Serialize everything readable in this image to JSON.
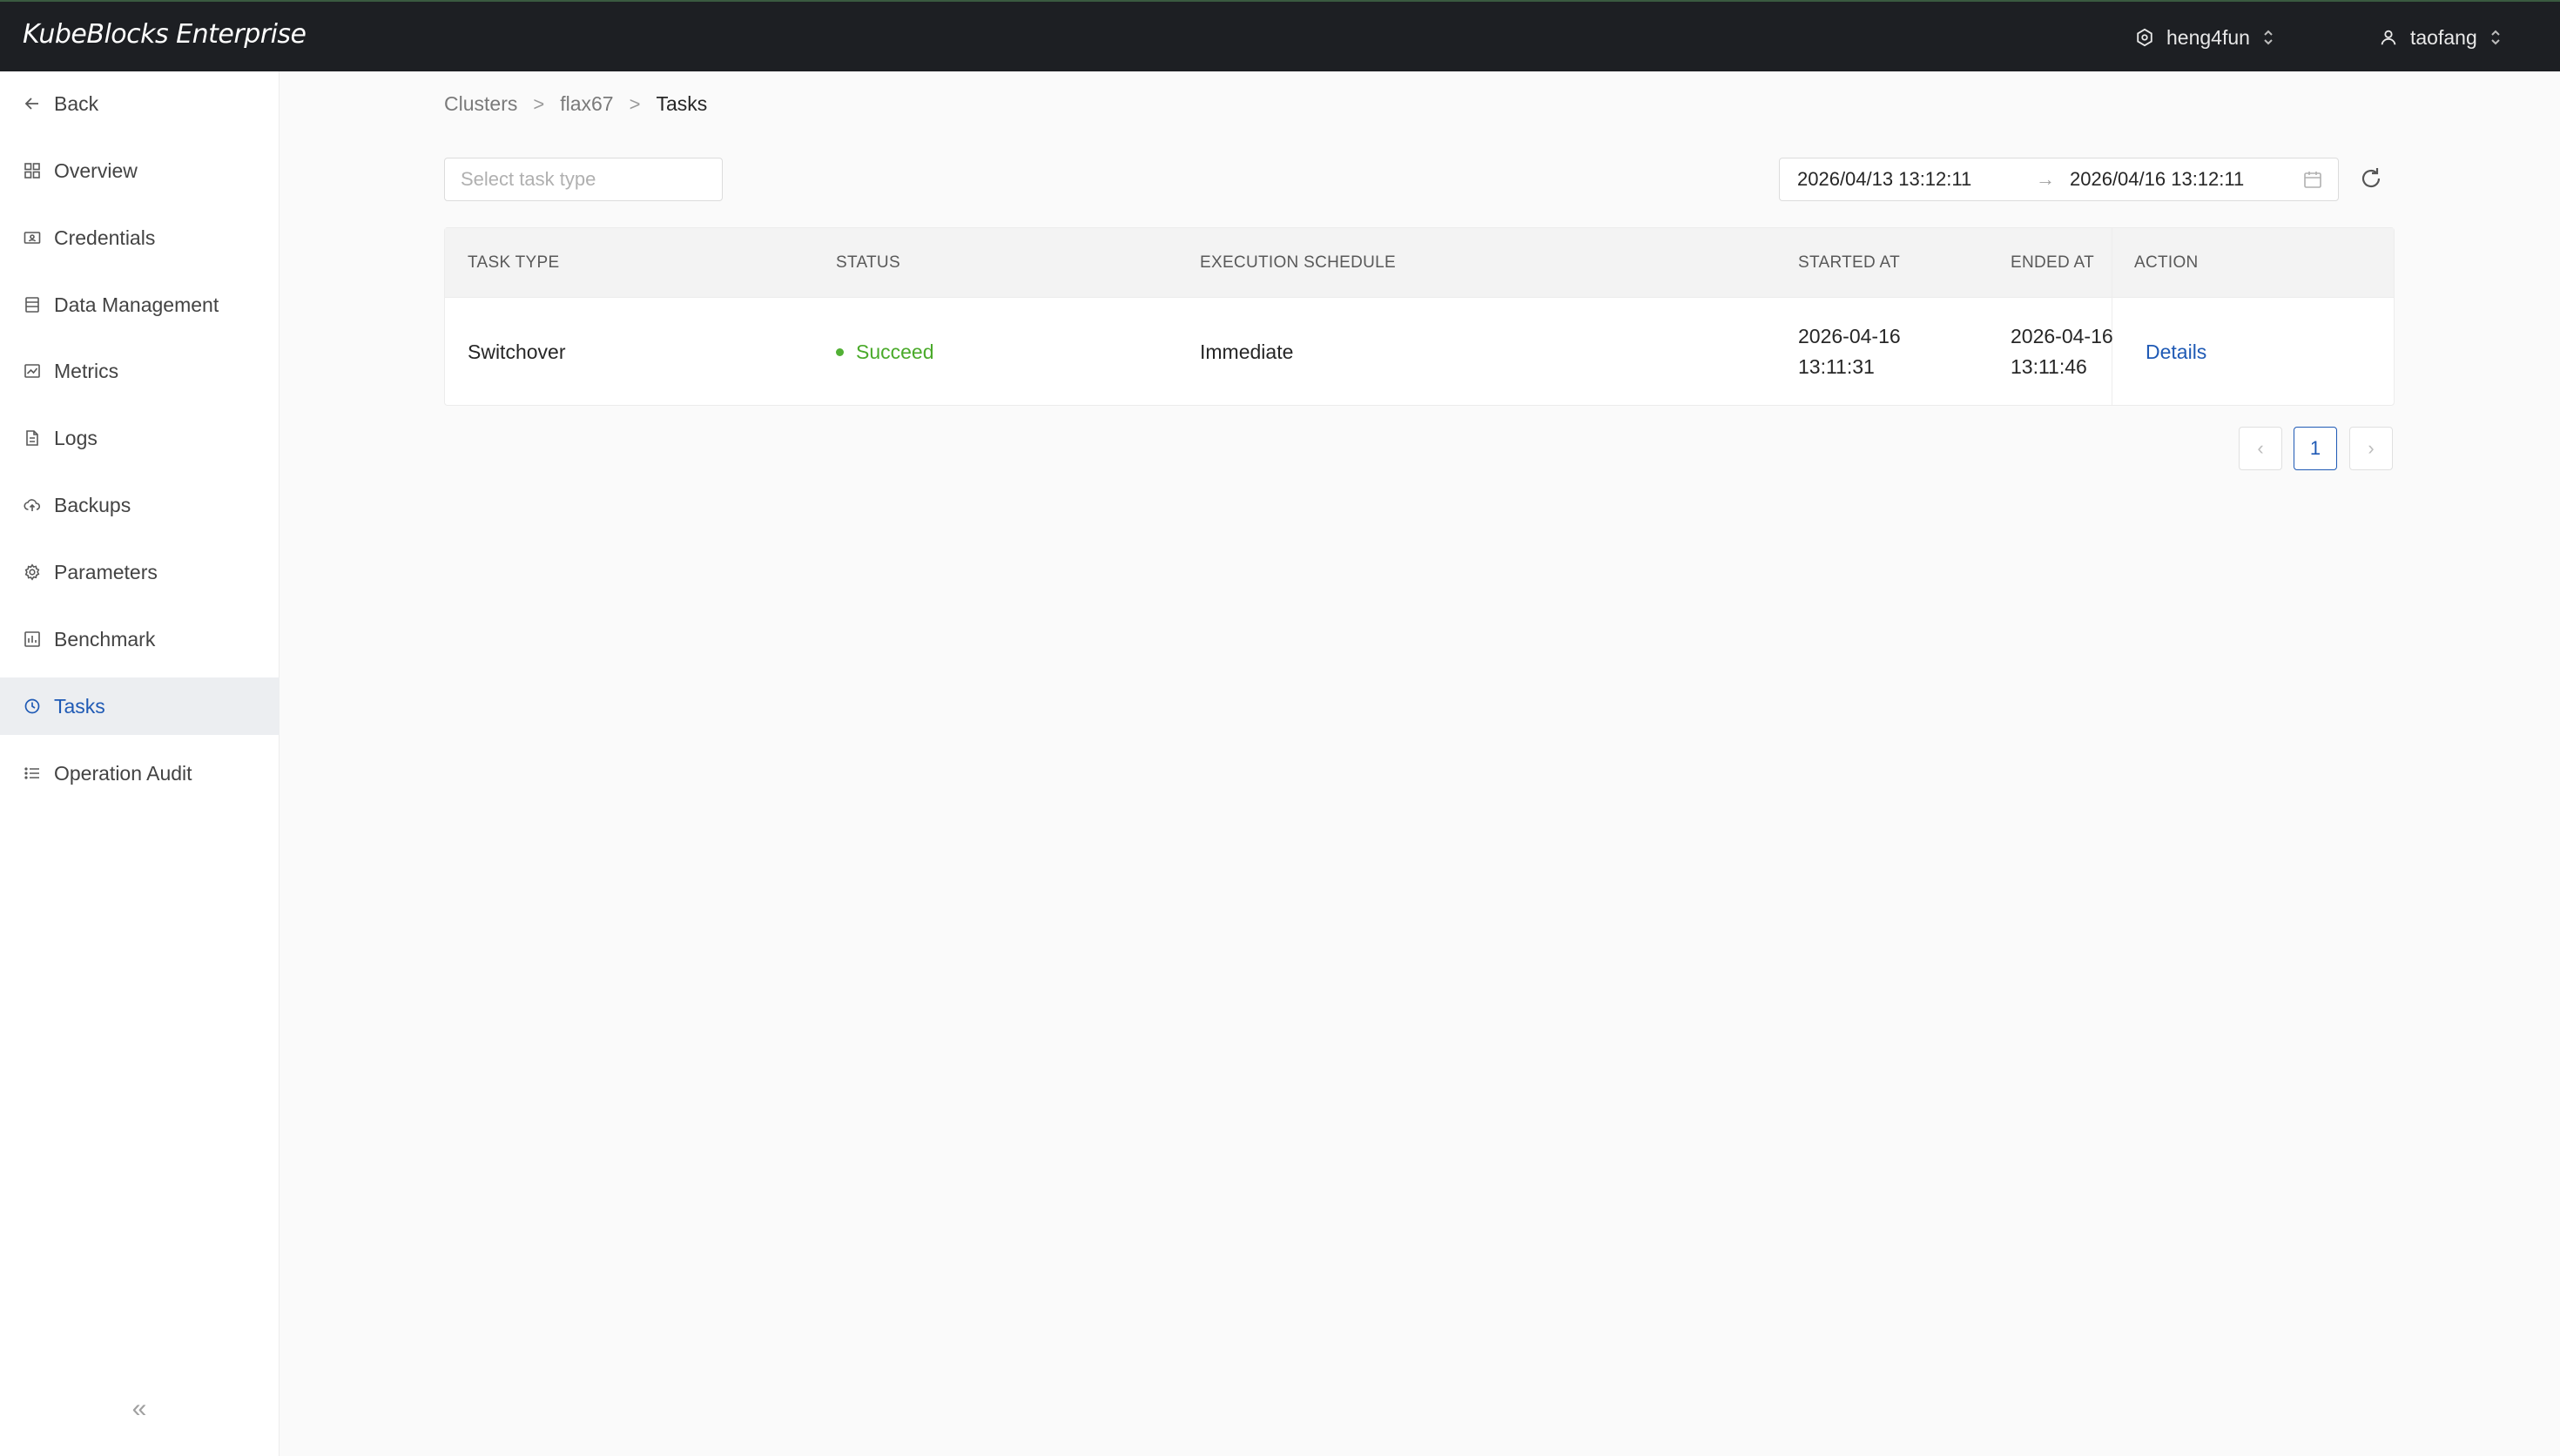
{
  "app": {
    "brand": "KubeBlocks Enterprise",
    "namespace": "heng4fun",
    "user": "taofang"
  },
  "sidebar": {
    "back_label": "Back",
    "items": [
      {
        "label": "Overview",
        "icon": "grid-icon"
      },
      {
        "label": "Credentials",
        "icon": "id-card-icon"
      },
      {
        "label": "Data Management",
        "icon": "database-icon"
      },
      {
        "label": "Metrics",
        "icon": "line-chart-icon"
      },
      {
        "label": "Logs",
        "icon": "document-icon"
      },
      {
        "label": "Backups",
        "icon": "cloud-upload-icon"
      },
      {
        "label": "Parameters",
        "icon": "gear-icon"
      },
      {
        "label": "Benchmark",
        "icon": "bar-chart-icon"
      },
      {
        "label": "Tasks",
        "icon": "clock-icon",
        "active": true
      },
      {
        "label": "Operation Audit",
        "icon": "list-icon"
      }
    ],
    "collapse_glyph": "«"
  },
  "breadcrumb": {
    "items": [
      "Clusters",
      "flax67",
      "Tasks"
    ]
  },
  "filters": {
    "task_type_placeholder": "Select task type",
    "date_start": "2026/04/13 13:12:11",
    "date_end": "2026/04/16 13:12:11",
    "date_separator": "→"
  },
  "table": {
    "columns": [
      "TASK TYPE",
      "STATUS",
      "EXECUTION SCHEDULE",
      "STARTED AT",
      "ENDED AT",
      "ACTION"
    ],
    "rows": [
      {
        "task_type": "Switchover",
        "status": "Succeed",
        "schedule": "Immediate",
        "started_date": "2026-04-16",
        "started_time": "13:11:31",
        "ended_date": "2026-04-16",
        "ended_time": "13:11:46",
        "action": "Details"
      }
    ]
  },
  "pagination": {
    "prev": "‹",
    "current": "1",
    "next": "›"
  },
  "colors": {
    "topbar": "#1d1f23",
    "accent": "#1f5ab5",
    "success": "#52b035"
  }
}
